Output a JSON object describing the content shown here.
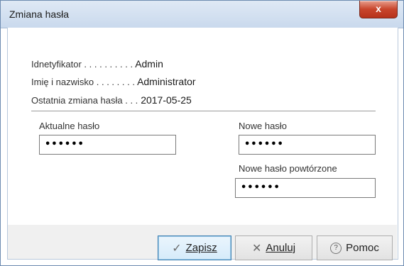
{
  "window": {
    "title": "Zmiana hasła",
    "close_label": "x"
  },
  "info": {
    "id_label": "Idnetyfikator . . . . . . . . . .",
    "id_value": "Admin",
    "name_label": "Imię i nazwisko . . . . . . . .",
    "name_value": "Administrator",
    "last_change_label": "Ostatnia zmiana hasła . . .",
    "last_change_value": "2017-05-25"
  },
  "form": {
    "current_label": "Aktualne hasło",
    "current_value": "••••••",
    "new_label": "Nowe hasło",
    "new_value": "••••••",
    "repeat_label": "Nowe hasło powtórzone",
    "repeat_value": "••••••"
  },
  "buttons": {
    "save_label": "Zapisz",
    "cancel_label": "Anuluj",
    "help_label": "Pomoc"
  },
  "icons": {
    "save": "check-icon",
    "cancel": "x-icon",
    "help": "question-icon"
  }
}
